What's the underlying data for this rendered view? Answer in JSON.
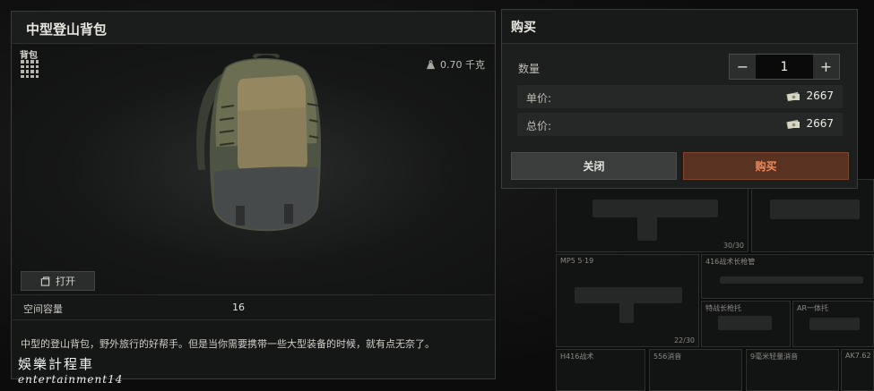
{
  "item": {
    "title": "中型登山背包",
    "category_label": "背包",
    "weight": "0.70 千克",
    "open_button": "打开",
    "stats": [
      {
        "label": "空间容量",
        "value": "16"
      }
    ],
    "description": "中型的登山背包，野外旅行的好帮手。但是当你需要携带一些大型装备的时候，就有点无奈了。"
  },
  "purchase": {
    "title": "购买",
    "quantity_label": "数量",
    "quantity": "1",
    "decrement": "−",
    "increment": "+",
    "unit_price_label": "单价:",
    "unit_price": "2667",
    "total_price_label": "总价:",
    "total_price": "2667",
    "close_button": "关闭",
    "buy_button": "购买"
  },
  "background_grid": {
    "cells": [
      {
        "label": "",
        "count": "30/30"
      },
      {
        "label": "MP5\n5·19",
        "count": "22/30"
      },
      {
        "label": "416战术长枪管",
        "count": ""
      },
      {
        "label": "特战长枪托",
        "count": ""
      },
      {
        "label": "AR一体托",
        "count": ""
      },
      {
        "label": "H416战术",
        "count": ""
      },
      {
        "label": "556消音",
        "count": ""
      },
      {
        "label": "9毫米轻量消音",
        "count": ""
      },
      {
        "label": "AK7.62",
        "count": ""
      }
    ]
  },
  "watermark": {
    "chinese": "娛樂計程車",
    "english": "entertainment14"
  },
  "colors": {
    "accent_buy": "#f08a55",
    "buy_button_bg": "#5a3222",
    "panel_bg": "#151616",
    "dialog_bg": "#1d1e1e"
  },
  "icons": [
    "grid-icon",
    "weight-icon",
    "open-icon",
    "money-icon"
  ]
}
